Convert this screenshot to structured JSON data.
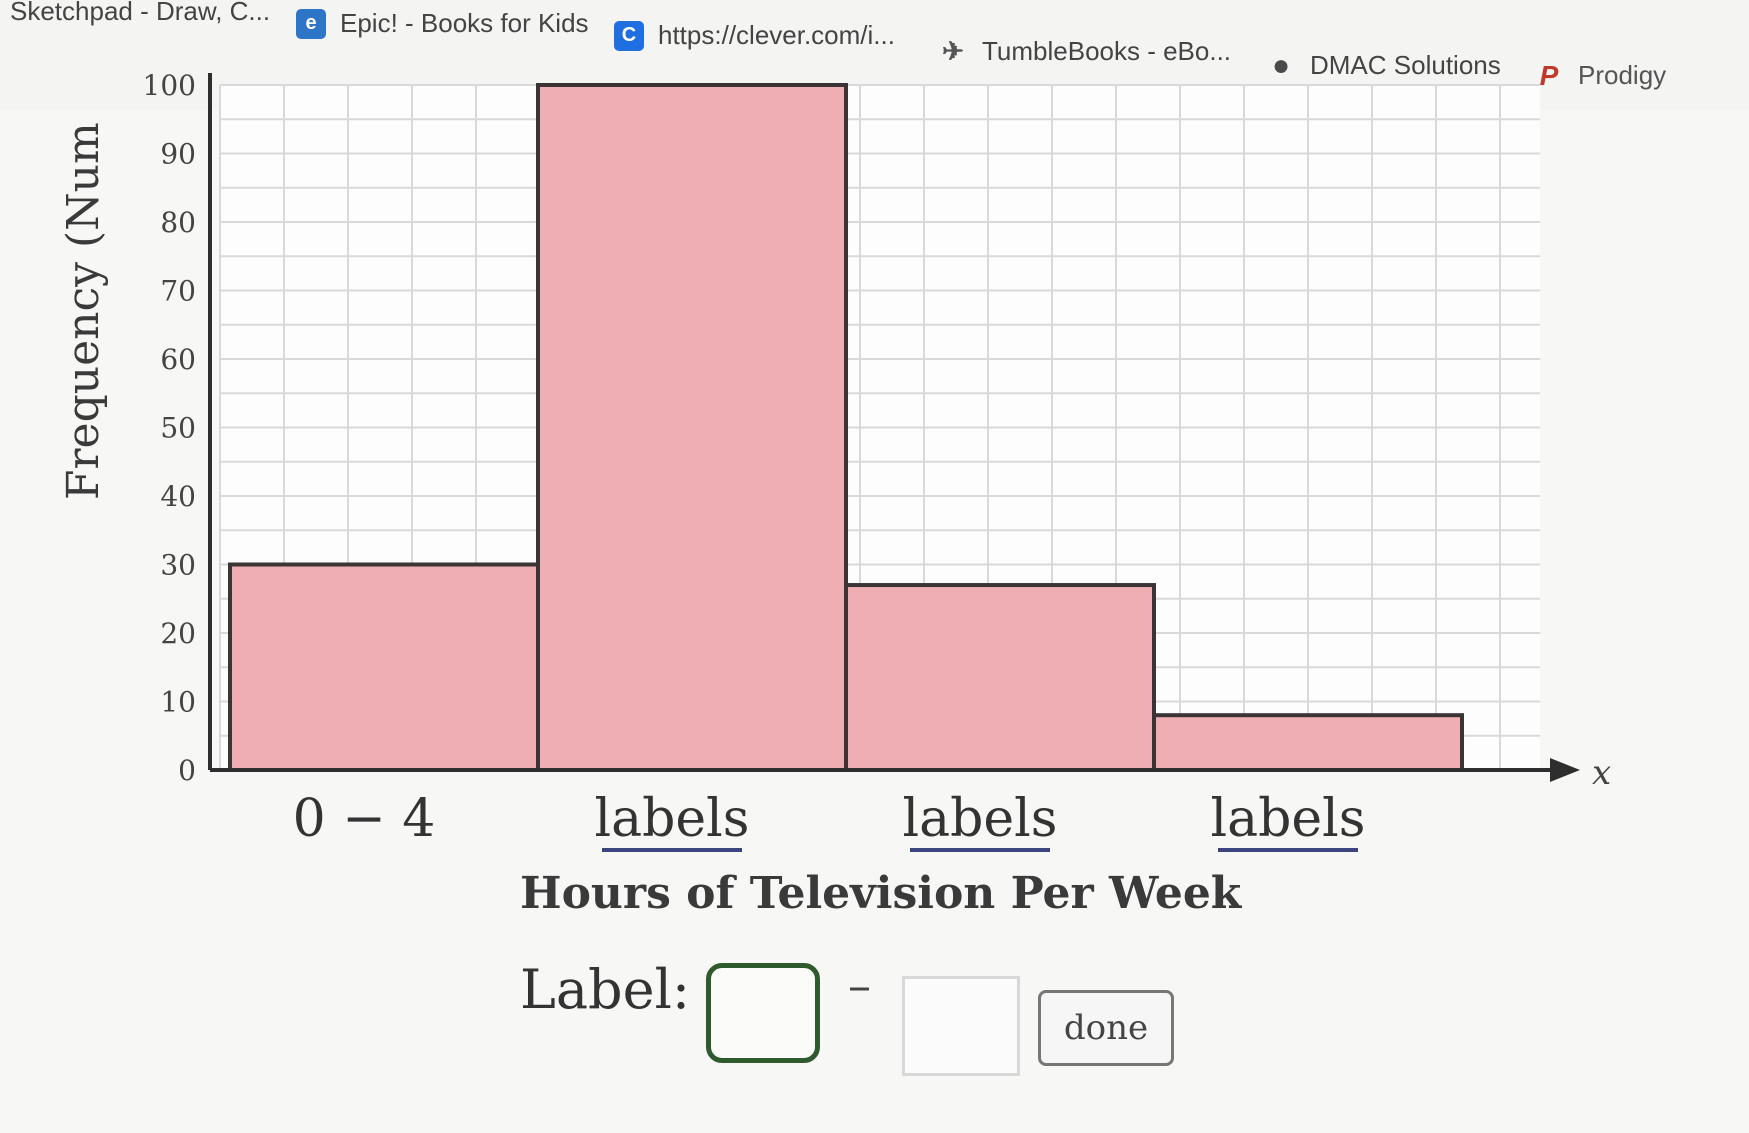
{
  "bookmarks": [
    {
      "label": "Sketchpad - Draw, C...",
      "icon": "none"
    },
    {
      "label": "Epic! - Books for Kids",
      "icon": "epic-logo-icon",
      "icon_text": "e",
      "color": "#2e74c7"
    },
    {
      "label": "https://clever.com/i...",
      "icon": "clever-logo-icon",
      "icon_text": "C",
      "color": "#1f6fe0"
    },
    {
      "label": "TumbleBooks - eBo...",
      "icon": "tumblebooks-logo-icon",
      "icon_text": "✈",
      "color": "#555555"
    },
    {
      "label": "DMAC Solutions",
      "icon": "dmac-logo-icon",
      "icon_text": "●",
      "color": "#555555"
    },
    {
      "label": "Prodigy",
      "icon": "prodigy-logo-icon",
      "icon_text": "P",
      "color": "#c0392b"
    }
  ],
  "chart_data": {
    "type": "bar",
    "categories": [
      "0 − 4",
      "labels",
      "labels",
      "labels"
    ],
    "values": [
      30,
      100,
      27,
      8
    ],
    "y_ticks": [
      "0",
      "10",
      "20",
      "30",
      "40",
      "50",
      "60",
      "70",
      "80",
      "90",
      "100"
    ],
    "ylim": [
      0,
      100
    ],
    "ylabel": "Frequency (Num",
    "xlabel": "Hours of Television Per Week",
    "x_axis_symbol": "x",
    "bar_color": "#eeaeb4",
    "grid": true
  },
  "label_controls": {
    "label_text": "Label:",
    "separator": "–",
    "first_value": "",
    "second_value": "",
    "done_label": "done"
  }
}
